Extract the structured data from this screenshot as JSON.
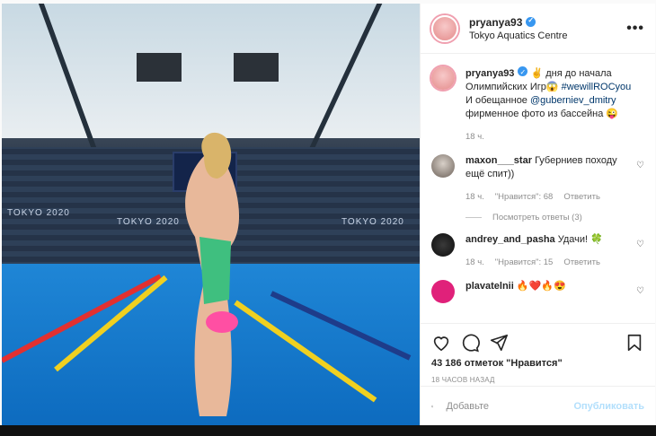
{
  "post": {
    "username": "pryanya93",
    "location": "Tokyo Aquatics Centre",
    "more_icon": "more-horizontal-icon"
  },
  "caption": {
    "username": "pryanya93",
    "text_1": " ✌️ дня до начала Олимпийских Игр😱 ",
    "hashtag": "#wewillROCyou",
    "text_2": " И обещанное ",
    "mention": "@guberniev_dmitry",
    "text_3": " фирменное фото из бассейна 😜",
    "time": "18 ч."
  },
  "comments": [
    {
      "username": "maxon___star",
      "text": "Губерниев походу ещё спит))",
      "time": "18 ч.",
      "likes": "\"Нравится\": 68",
      "reply": "Ответить",
      "view_replies": "Посмотреть ответы (3)"
    },
    {
      "username": "andrey_and_pasha",
      "text": "Удачи! 🍀",
      "time": "18 ч.",
      "likes": "\"Нравится\": 15",
      "reply": "Ответить"
    },
    {
      "username": "plavatelnii",
      "text": "🔥❤️🔥😍"
    }
  ],
  "actions": {
    "likes_count": "43 186 отметок \"Нравится\"",
    "posted_ago": "18 ЧАСОВ НАЗАД"
  },
  "add_comment": {
    "placeholder": "Добавьте",
    "post_label": "Опубликовать"
  },
  "photo": {
    "banner_left": "TOKYO 2020",
    "banner_mid": "TOKYO 2020",
    "banner_right": "TOKYO 2020"
  },
  "colors": {
    "link": "#00376b",
    "verified": "#3897f0",
    "post_disabled": "#b2dffc"
  }
}
